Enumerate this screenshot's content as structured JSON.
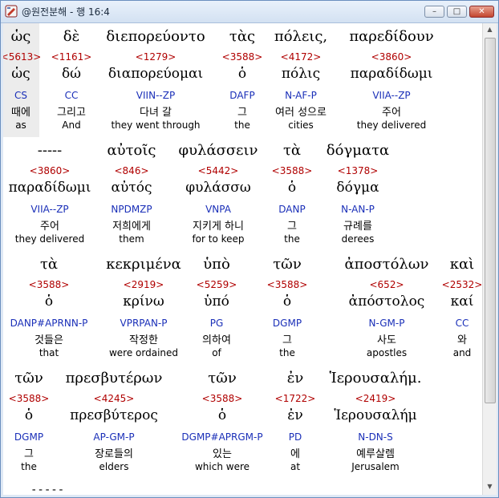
{
  "window": {
    "title": "@원전분해 - 행 16:4",
    "min": "–",
    "max": "□",
    "close": "✕"
  },
  "rows": [
    {
      "words": [
        {
          "greek": "ὡς",
          "num": "<5613>",
          "lemma": "ὡς",
          "morph": "CS",
          "kor": "때에",
          "eng": "as"
        },
        {
          "greek": "δὲ",
          "num": "<1161>",
          "lemma": "δώ",
          "morph": "CC",
          "kor": "그리고",
          "eng": "And"
        },
        {
          "greek": "διεπορεύοντο",
          "num": "<1279>",
          "lemma": "διαπορεύομαι",
          "morph": "VIIN--ZP",
          "kor": "다녀 갈",
          "eng": "they went through"
        },
        {
          "greek": "τὰς",
          "num": "<3588>",
          "lemma": "ὁ",
          "morph": "DAFP",
          "kor": "그",
          "eng": "the"
        },
        {
          "greek": "πόλεις,",
          "num": "<4172>",
          "lemma": "πόλις",
          "morph": "N-AF-P",
          "kor": "여러 성으로",
          "eng": "cities"
        },
        {
          "greek": "παρεδίδουν",
          "num": "<3860>",
          "lemma": "παραδίδωμι",
          "morph": "VIIA--ZP",
          "kor": "주어",
          "eng": "they delivered"
        }
      ]
    },
    {
      "words": [
        {
          "greek": "-----",
          "num": "<3860>",
          "lemma": "παραδίδωμι",
          "morph": "VIIA--ZP",
          "kor": "주어",
          "eng": "they delivered"
        },
        {
          "greek": "αὐτοῖς",
          "num": "<846>",
          "lemma": "αὐτός",
          "morph": "NPDMZP",
          "kor": "저희에게",
          "eng": "them"
        },
        {
          "greek": "φυλάσσειν",
          "num": "<5442>",
          "lemma": "φυλάσσω",
          "morph": "VNPA",
          "kor": "지키게 하니",
          "eng": "for to keep"
        },
        {
          "greek": "τὰ",
          "num": "<3588>",
          "lemma": "ὁ",
          "morph": "DANP",
          "kor": "그",
          "eng": "the"
        },
        {
          "greek": "δόγματα",
          "num": "<1378>",
          "lemma": "δόγμα",
          "morph": "N-AN-P",
          "kor": "규례를",
          "eng": "derees"
        }
      ]
    },
    {
      "words": [
        {
          "greek": "τὰ",
          "num": "<3588>",
          "lemma": "ὁ",
          "morph": "DANP#APRNN-P",
          "kor": "것들은",
          "eng": "that"
        },
        {
          "greek": "κεκριμένα",
          "num": "<2919>",
          "lemma": "κρίνω",
          "morph": "VPRPAN-P",
          "kor": "작정한",
          "eng": "were ordained"
        },
        {
          "greek": "ὑπὸ",
          "num": "<5259>",
          "lemma": "ὑπό",
          "morph": "PG",
          "kor": "의하여",
          "eng": "of"
        },
        {
          "greek": "τῶν",
          "num": "<3588>",
          "lemma": "ὁ",
          "morph": "DGMP",
          "kor": "그",
          "eng": "the"
        },
        {
          "greek": "ἀποστόλων",
          "num": "<652>",
          "lemma": "ἀπόστολος",
          "morph": "N-GM-P",
          "kor": "사도",
          "eng": "apostles"
        },
        {
          "greek": "καὶ",
          "num": "<2532>",
          "lemma": "καί",
          "morph": "CC",
          "kor": "와",
          "eng": "and"
        }
      ]
    },
    {
      "words": [
        {
          "greek": "τῶν",
          "num": "<3588>",
          "lemma": "ὁ",
          "morph": "DGMP",
          "kor": "그",
          "eng": "the"
        },
        {
          "greek": "πρεσβυτέρων",
          "num": "<4245>",
          "lemma": "πρεσβύτερος",
          "morph": "AP-GM-P",
          "kor": "장로들의",
          "eng": "elders"
        },
        {
          "greek": "τῶν",
          "num": "<3588>",
          "lemma": "ὁ",
          "morph": "DGMP#APRGM-P",
          "kor": "있는",
          "eng": "which were"
        },
        {
          "greek": "ἐν",
          "num": "<1722>",
          "lemma": "ἐν",
          "morph": "PD",
          "kor": "에",
          "eng": "at"
        },
        {
          "greek": "Ἱερουσαλήμ.",
          "num": "<2419>",
          "lemma": "Ἱερουσαλήμ",
          "morph": "N-DN-S",
          "kor": "예루살렘",
          "eng": "Jerusalem"
        }
      ]
    }
  ],
  "trailing": "-----"
}
